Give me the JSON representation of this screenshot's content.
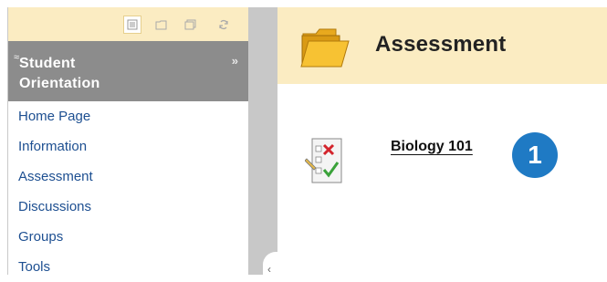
{
  "toolbar": {
    "buttons": [
      {
        "icon": "list-view-icon",
        "active": true
      },
      {
        "icon": "folder-view-icon",
        "active": false
      },
      {
        "icon": "window-icon",
        "active": false
      },
      {
        "icon": "refresh-icon",
        "active": false
      }
    ]
  },
  "sidebar": {
    "course_title_line1": "Student",
    "course_title_line2": "Orientation",
    "collapse_glyph": "≈",
    "expand_glyph": "»",
    "items": [
      {
        "label": "Home Page"
      },
      {
        "label": "Information"
      },
      {
        "label": "Assessment"
      },
      {
        "label": "Discussions"
      },
      {
        "label": "Groups"
      },
      {
        "label": "Tools"
      }
    ]
  },
  "gutter": {
    "handle_glyph": "‹"
  },
  "main": {
    "title": "Assessment",
    "item_link": "Biology 101",
    "step_number": "1"
  },
  "colors": {
    "header_bg": "#fbecc2",
    "course_header_bg": "#8c8c8c",
    "link": "#1d4f91",
    "badge": "#1f7ac4"
  }
}
